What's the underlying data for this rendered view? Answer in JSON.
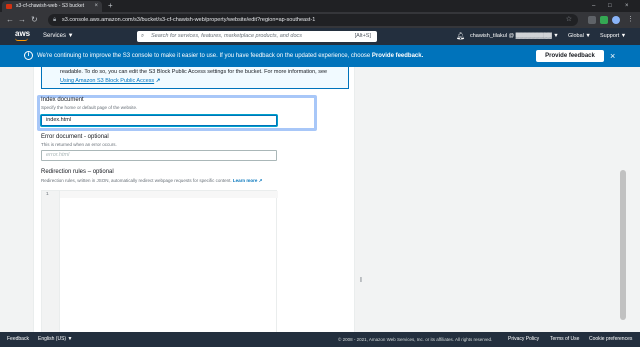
{
  "browser": {
    "tab_title": "s3-cf-chawish-web - S3 bucket",
    "tab_close": "×",
    "new_tab": "+",
    "url": "s3.console.aws.amazon.com/s3/bucket/s3-cf-chawish-web/property/website/edit?region=ap-southeast-1",
    "window_controls": [
      "–",
      "□",
      "×"
    ]
  },
  "aws_nav": {
    "logo": "aws",
    "services_label": "Services ▼",
    "search_placeholder": "Search for services, features, marketplace products, and docs",
    "search_shortcut": "[Alt+S]",
    "account_label": "chawish_tilakul @ ▓▓▓▓▓▓▓▓▓ ▼",
    "region_label": "Global ▼",
    "support_label": "Support ▼"
  },
  "flash": {
    "message_prefix": "We're continuing to improve the S3 console to make it easier to use. If you have feedback on the updated experience, choose ",
    "message_bold": "Provide feedback.",
    "button_label": "Provide feedback",
    "close": "×"
  },
  "callout": {
    "line1": "readable. To do so, you can edit the S3 Block Public Access settings for the bucket. For more information, see",
    "link": "Using Amazon S3 Block Public Access",
    "link_icon": "↗"
  },
  "index_document": {
    "label": "Index document",
    "description": "Specify the home or default page of the website.",
    "value": "index.html"
  },
  "error_document": {
    "label": "Error document - optional",
    "description": "This is returned when an error occurs.",
    "placeholder": "error.html"
  },
  "redirection_rules": {
    "label": "Redirection rules – optional",
    "description": "Redirection rules, written in JSON, automatically redirect webpage requests for specific content.",
    "learn_more": "Learn more",
    "line_number": "1"
  },
  "footer": {
    "feedback": "Feedback",
    "language": "English (US) ▼",
    "copyright": "© 2008 - 2021, Amazon Web Services, Inc. or its affiliates. All rights reserved.",
    "privacy": "Privacy Policy",
    "terms": "Terms of Use",
    "cookies": "Cookie preferences"
  },
  "colors": {
    "aws_nav": "#232f3e",
    "flash_blue": "#0073bb",
    "link_blue": "#0073bb",
    "aws_orange": "#ff9900"
  }
}
